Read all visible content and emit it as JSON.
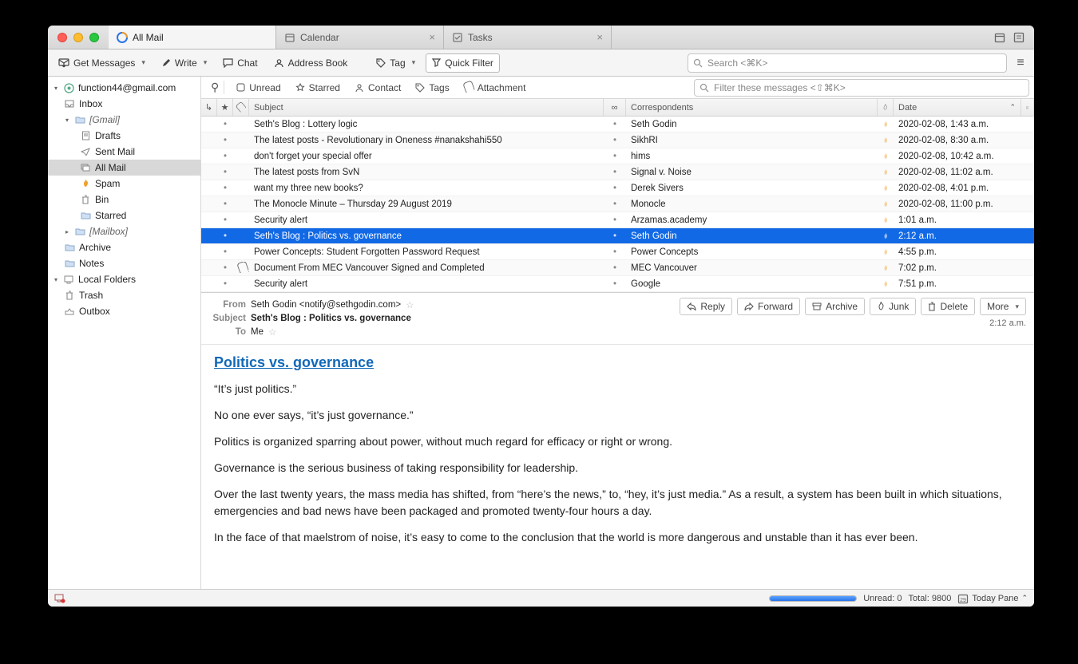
{
  "tabs": {
    "mail": "All Mail",
    "calendar": "Calendar",
    "tasks": "Tasks"
  },
  "toolbar": {
    "get_messages": "Get Messages",
    "write": "Write",
    "chat": "Chat",
    "address_book": "Address Book",
    "tag": "Tag",
    "quick_filter": "Quick Filter",
    "search_placeholder": "Search <⌘K>"
  },
  "folders": {
    "account": "function44@gmail.com",
    "inbox": "Inbox",
    "gmail": "[Gmail]",
    "drafts": "Drafts",
    "sent": "Sent Mail",
    "all_mail": "All Mail",
    "spam": "Spam",
    "bin": "Bin",
    "starred": "Starred",
    "mailbox": "[Mailbox]",
    "archive": "Archive",
    "notes": "Notes",
    "local": "Local Folders",
    "trash": "Trash",
    "outbox": "Outbox"
  },
  "filterbar": {
    "unread": "Unread",
    "starred": "Starred",
    "contact": "Contact",
    "tags": "Tags",
    "attachment": "Attachment",
    "filter_placeholder": "Filter these messages <⇧⌘K>"
  },
  "columns": {
    "subject": "Subject",
    "correspondents": "Correspondents",
    "date": "Date"
  },
  "messages": [
    {
      "subject": "Seth's Blog : Lottery logic",
      "corr": "Seth Godin",
      "date": "2020-02-08, 1:43 a.m.",
      "att": false
    },
    {
      "subject": "The latest posts - Revolutionary in Oneness #nanakshahi550",
      "corr": "SikhRI",
      "date": "2020-02-08, 8:30 a.m.",
      "att": false
    },
    {
      "subject": "don't forget your special offer",
      "corr": "hims",
      "date": "2020-02-08, 10:42 a.m.",
      "att": false
    },
    {
      "subject": "The latest posts from SvN",
      "corr": "Signal v. Noise",
      "date": "2020-02-08, 11:02 a.m.",
      "att": false
    },
    {
      "subject": "want my three new books?",
      "corr": "Derek Sivers",
      "date": "2020-02-08, 4:01 p.m.",
      "att": false
    },
    {
      "subject": "The Monocle Minute – Thursday 29 August 2019",
      "corr": "Monocle",
      "date": "2020-02-08, 11:00 p.m.",
      "att": false
    },
    {
      "subject": "Security alert",
      "corr": "Arzamas.academy",
      "date": "1:01 a.m.",
      "att": false
    },
    {
      "subject": "Seth's Blog : Politics vs. governance",
      "corr": "Seth Godin",
      "date": "2:12 a.m.",
      "att": false,
      "selected": true
    },
    {
      "subject": "Power Concepts: Student Forgotten Password Request",
      "corr": "Power Concepts",
      "date": "4:55 p.m.",
      "att": false
    },
    {
      "subject": "Document From MEC Vancouver Signed and Completed",
      "corr": "MEC Vancouver",
      "date": "7:02 p.m.",
      "att": true
    },
    {
      "subject": "Security alert",
      "corr": "Google",
      "date": "7:51 p.m.",
      "att": false
    }
  ],
  "header": {
    "from_label": "From",
    "from_value": "Seth Godin <notify@sethgodin.com>",
    "subject_label": "Subject",
    "subject_value": "Seth's Blog : Politics vs. governance",
    "to_label": "To",
    "to_value": "Me",
    "time": "2:12 a.m.",
    "reply": "Reply",
    "forward": "Forward",
    "archive": "Archive",
    "junk": "Junk",
    "delete": "Delete",
    "more": "More"
  },
  "content": {
    "title": "Politics vs. governance",
    "p1": "“It’s just politics.”",
    "p2": "No one ever says, “it’s just governance.”",
    "p3": "Politics is organized sparring about power, without much regard for efficacy or right or wrong.",
    "p4": "Governance is the serious business of taking responsibility for leadership.",
    "p5": "Over the last twenty years, the mass media has shifted, from “here’s the news,” to, “hey, it’s just media.” As a result, a system has been built in which situations, emergencies and bad news have been packaged and promoted twenty-four hours a day.",
    "p6": "In the face of that maelstrom of noise, it’s easy to come to the conclusion that the world is more dangerous and unstable than it has ever been."
  },
  "status": {
    "unread": "Unread: 0",
    "total": "Total: 9800",
    "today_pane": "Today Pane"
  }
}
